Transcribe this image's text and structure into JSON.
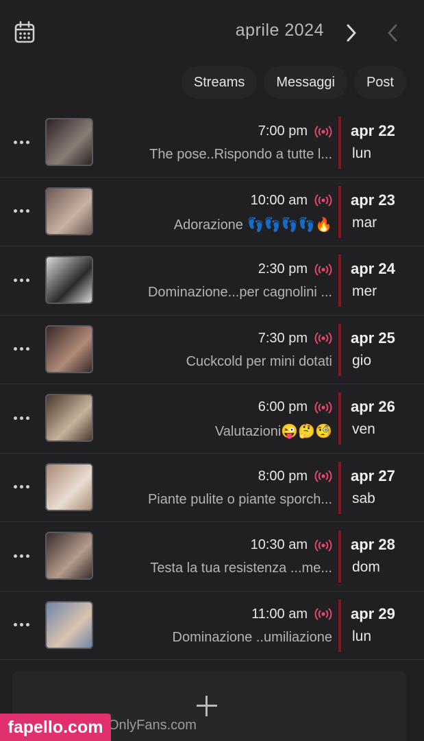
{
  "header": {
    "title": "aprile 2024"
  },
  "tabs": [
    {
      "label": "Post"
    },
    {
      "label": "Messaggi"
    },
    {
      "label": "Streams"
    }
  ],
  "events": [
    {
      "date": "apr 22",
      "day": "lun",
      "time": "7:00 pm",
      "title": "The pose..Rispondo a tutte l...",
      "thumb_colors": [
        "#2b2424",
        "#8a7d76"
      ]
    },
    {
      "date": "apr 23",
      "day": "mar",
      "time": "10:00 am",
      "title": "Adorazione 👣👣👣👣🔥",
      "thumb_colors": [
        "#6d5a52",
        "#c9b2a3"
      ]
    },
    {
      "date": "apr 24",
      "day": "mer",
      "time": "2:30 pm",
      "title": "Dominazione...per cagnolini ...",
      "thumb_colors": [
        "#d8d8d8",
        "#2a2a2a"
      ]
    },
    {
      "date": "apr 25",
      "day": "gio",
      "time": "7:30 pm",
      "title": "Cuckcold per mini dotati",
      "thumb_colors": [
        "#3a2a28",
        "#b08a78"
      ]
    },
    {
      "date": "apr 26",
      "day": "ven",
      "time": "6:00 pm",
      "title": "Valutazioni😜🤔🧐",
      "thumb_colors": [
        "#4a3a30",
        "#c6b39a"
      ]
    },
    {
      "date": "apr 27",
      "day": "sab",
      "time": "8:00 pm",
      "title": "Piante pulite o piante sporch...",
      "thumb_colors": [
        "#a98a76",
        "#e8ddd2"
      ]
    },
    {
      "date": "apr 28",
      "day": "dom",
      "time": "10:30 am",
      "title": "Testa la tua resistenza ...me...",
      "thumb_colors": [
        "#3a2e2c",
        "#b49c8c"
      ]
    },
    {
      "date": "apr 29",
      "day": "lun",
      "time": "11:00 am",
      "title": "Dominazione ..umiliazione",
      "thumb_colors": [
        "#6f86a6",
        "#d9c3b0"
      ]
    }
  ],
  "footer": {
    "text": "OnlyFans.com"
  },
  "watermark": {
    "text": "fapello.com"
  },
  "colors": {
    "accent": "#8b1220",
    "live": "#e5486d"
  }
}
